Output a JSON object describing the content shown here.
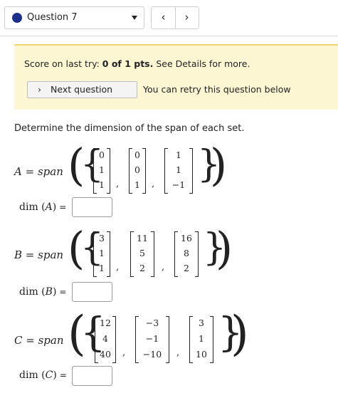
{
  "topbar": {
    "question_label": "Question 7",
    "prev_glyph": "‹",
    "next_glyph": "›",
    "dot_color": "#1d2f8c"
  },
  "score": {
    "prefix": "Score on last try: ",
    "value": "0 of 1 pts.",
    "suffix": " See Details for more.",
    "next_button": "Next question",
    "retry_text": "You can retry this question below"
  },
  "prompt": "Determine the dimension of the span of each set.",
  "sets": [
    {
      "name": "A",
      "span_word": "span",
      "vectors": [
        [
          "0",
          "1",
          "1"
        ],
        [
          "0",
          "0",
          "1"
        ],
        [
          "1",
          "1",
          "−1"
        ]
      ],
      "dim_label": "dim",
      "dim_value": ""
    },
    {
      "name": "B",
      "span_word": "span",
      "vectors": [
        [
          "3",
          "1",
          "1"
        ],
        [
          "11",
          "5",
          "2"
        ],
        [
          "16",
          "8",
          "2"
        ]
      ],
      "dim_label": "dim",
      "dim_value": ""
    },
    {
      "name": "C",
      "span_word": "span",
      "vectors": [
        [
          "12",
          "4",
          "40"
        ],
        [
          "−3",
          "−1",
          "−10"
        ],
        [
          "3",
          "1",
          "10"
        ]
      ],
      "dim_label": "dim",
      "dim_value": ""
    }
  ]
}
